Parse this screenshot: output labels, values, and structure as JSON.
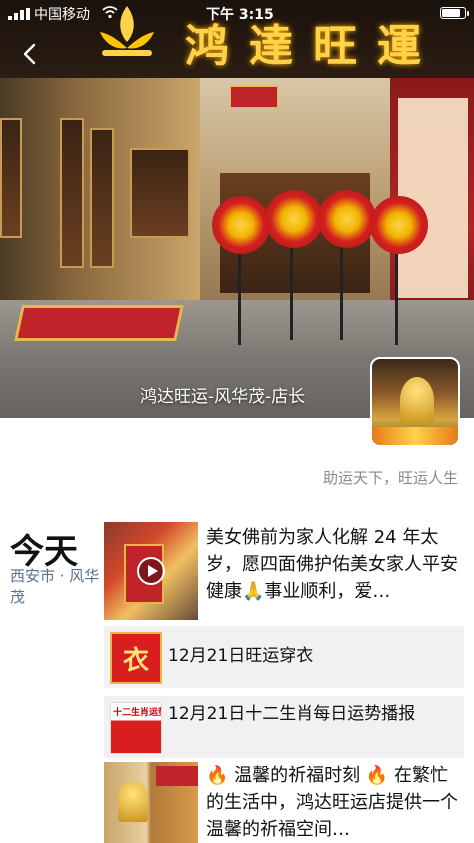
{
  "status_bar": {
    "carrier": "中国移动",
    "time": "下午 3:15"
  },
  "cover": {
    "sign_text": "鸿達旺運",
    "caption": "鸿达旺运-风华茂-店长"
  },
  "profile": {
    "signature": "助运天下，旺运人生"
  },
  "feed": {
    "day_label": "今天",
    "location": "西安市 · 风华茂",
    "posts": [
      {
        "type": "video",
        "text": "美女佛前为家人化解 24 年太岁，愿四面佛护佑美女家人平安健康🙏事业顺利，爱…"
      },
      {
        "type": "share",
        "thumb_text": "衣",
        "title": "12月21日旺运穿衣"
      },
      {
        "type": "share",
        "thumb_text": "十二生肖运势",
        "title": "12月21日十二生肖每日运势播报"
      },
      {
        "type": "image",
        "text": "🔥 温馨的祈福时刻 🔥 在繁忙的生活中，鸿达旺运店提供一个温馨的祈福空间…"
      }
    ]
  },
  "colors": {
    "link_blue": "#5a6f94",
    "signature_gray": "#8a8a8a",
    "share_bg": "#f1f1f1"
  }
}
